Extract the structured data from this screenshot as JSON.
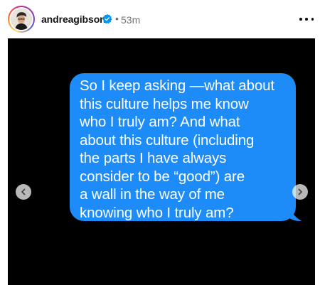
{
  "post": {
    "username": "andreagibson",
    "separator": "•",
    "timestamp": "53m"
  },
  "message": {
    "text": "So I keep asking —what about\nthis culture helps me know\nwho I truly am? And what\nabout this culture (including\nthe parts I have always\nconsider to be “good”) are\na wall in the way of me\nknowing who I truly am?"
  },
  "colors": {
    "bubble": "#1d8bf8",
    "media_background": "#000000",
    "verified_badge": "#0095f6",
    "timestamp": "#737373"
  },
  "icons": {
    "verified": "verified-badge-icon",
    "more": "more-options-icon",
    "prev": "chevron-left-icon",
    "next": "chevron-right-icon"
  }
}
